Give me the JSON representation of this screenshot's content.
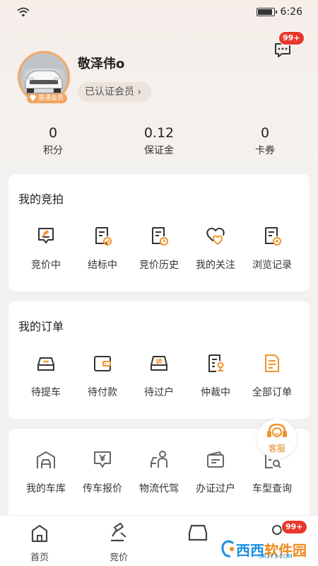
{
  "status_bar": {
    "time": "6:26"
  },
  "header": {
    "message_badge": "99+",
    "user_name": "敬泽伟o",
    "member_status": "已认证会员 ›",
    "vip_tag": "普通会员"
  },
  "stats": [
    {
      "value": "0",
      "label": "积分"
    },
    {
      "value": "0.12",
      "label": "保证金"
    },
    {
      "value": "0",
      "label": "卡券"
    }
  ],
  "auction": {
    "title": "我的竞拍",
    "items": [
      {
        "label": "竞价中",
        "icon": "gavel-icon"
      },
      {
        "label": "结标中",
        "icon": "doc-check-icon"
      },
      {
        "label": "竞价历史",
        "icon": "doc-clock-icon"
      },
      {
        "label": "我的关注",
        "icon": "heart-follow-icon"
      },
      {
        "label": "浏览记录",
        "icon": "browse-record-icon"
      }
    ]
  },
  "orders": {
    "title": "我的订单",
    "items": [
      {
        "label": "待提车",
        "icon": "car-icon"
      },
      {
        "label": "待付款",
        "icon": "wallet-icon"
      },
      {
        "label": "待过户",
        "icon": "transfer-car-icon"
      },
      {
        "label": "仲裁中",
        "icon": "arbitration-icon"
      },
      {
        "label": "全部订单",
        "icon": "all-orders-icon"
      }
    ]
  },
  "services": {
    "items": [
      {
        "label": "我的车库",
        "icon": "garage-icon"
      },
      {
        "label": "传车报价",
        "icon": "price-quote-icon"
      },
      {
        "label": "物流代驾",
        "icon": "driver-icon"
      },
      {
        "label": "办证过户",
        "icon": "license-icon"
      },
      {
        "label": "车型查询",
        "icon": "model-search-icon"
      }
    ]
  },
  "customer_service": {
    "label": "客服"
  },
  "tabbar": {
    "items": [
      {
        "label": "首页",
        "icon": "home-icon"
      },
      {
        "label": "竞价",
        "icon": "auction-icon"
      },
      {
        "label": "",
        "icon": "car-tab-icon"
      },
      {
        "label": "",
        "icon": "mine-icon"
      }
    ],
    "badge": "99+"
  },
  "watermark": {
    "text_a": "西西",
    "text_b": "软件园",
    "sub": "CR173.COM"
  },
  "colors": {
    "accent": "#e58a2c",
    "badge": "#e8372c"
  }
}
